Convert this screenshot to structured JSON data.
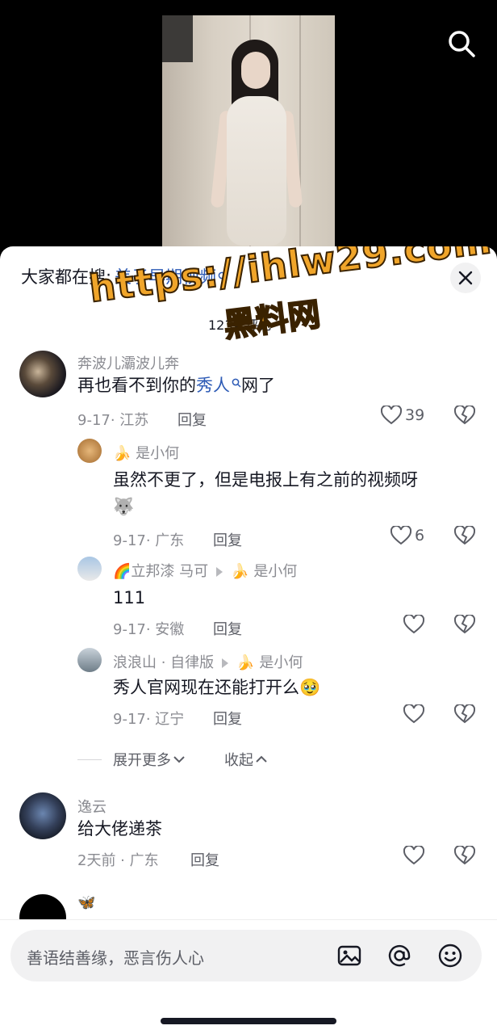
{
  "video": {
    "search_icon": "search-icon"
  },
  "sheet": {
    "hot_search_label": "大家都在搜:",
    "hot_search_term": "美子早期视频",
    "comment_count": "123条评论",
    "close_icon": "close-icon"
  },
  "watermark": {
    "url": "https://ihlw29.com",
    "name": "黑料网"
  },
  "comments": [
    {
      "username": "奔波儿灞波儿奔",
      "text_before": "再也看不到你的",
      "link_term": "秀人",
      "text_after": "网了",
      "date_location": "9-17· 江苏",
      "reply": "回复",
      "likes": "39"
    },
    {
      "username_emoji": "🍌",
      "username": "是小何",
      "text": "虽然不更了，但是电报上有之前的视频呀",
      "text_emoji": "🐺",
      "date_location": "9-17· 广东",
      "reply": "回复",
      "likes": "6"
    },
    {
      "username_emoji": "🌈",
      "username": "立邦漆 马可",
      "reply_to_emoji": "🍌",
      "reply_to": "是小何",
      "text": "111",
      "date_location": "9-17· 安徽",
      "reply": "回复"
    },
    {
      "username": "浪浪山 · 自律版",
      "reply_to_emoji": "🍌",
      "reply_to": "是小何",
      "text": "秀人官网现在还能打开么",
      "text_emoji": "🥹",
      "date_location": "9-17· 辽宁",
      "reply": "回复"
    },
    {
      "username": "逸云",
      "text": "给大佬递茶",
      "date_location": "2天前 · 广东",
      "reply": "回复"
    },
    {
      "username_emoji": "🦋"
    }
  ],
  "thread": {
    "expand_more": "展开更多",
    "collapse": "收起"
  },
  "input_bar": {
    "placeholder": "善语结善缘，恶言伤人心",
    "icons": [
      "image-icon",
      "at-icon",
      "emoji-icon"
    ]
  },
  "colors": {
    "link": "#2c5ab5",
    "watermark": "#f0a52a",
    "muted": "#8a8b91"
  }
}
